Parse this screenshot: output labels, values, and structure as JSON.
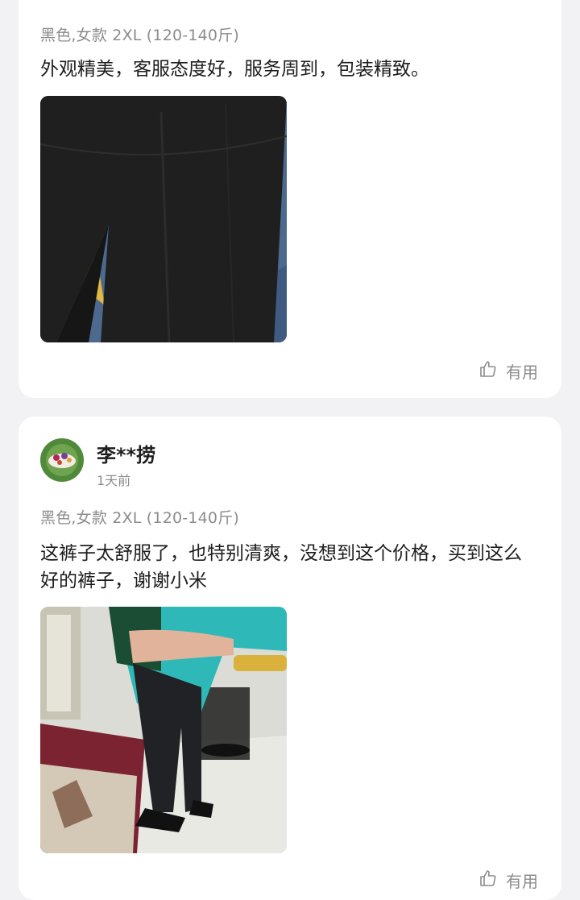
{
  "reviews": [
    {
      "variant": "黑色,女款 2XL (120-140斤)",
      "text": "外观精美，客服态度好，服务周到，包装精致。",
      "helpful_label": "有用"
    },
    {
      "username": "李**捞",
      "time": "1天前",
      "variant": "黑色,女款 2XL (120-140斤)",
      "text": "这裤子太舒服了，也特别清爽，没想到这个价格，买到这么好的裤子，谢谢小米",
      "helpful_label": "有用"
    }
  ],
  "icons": {
    "helpful": "thumbs-up-outline-icon"
  },
  "colors": {
    "background": "#f2f2f4",
    "card": "#ffffff",
    "secondary_text": "#8c8c8c",
    "primary_text": "#1e1e1e"
  }
}
